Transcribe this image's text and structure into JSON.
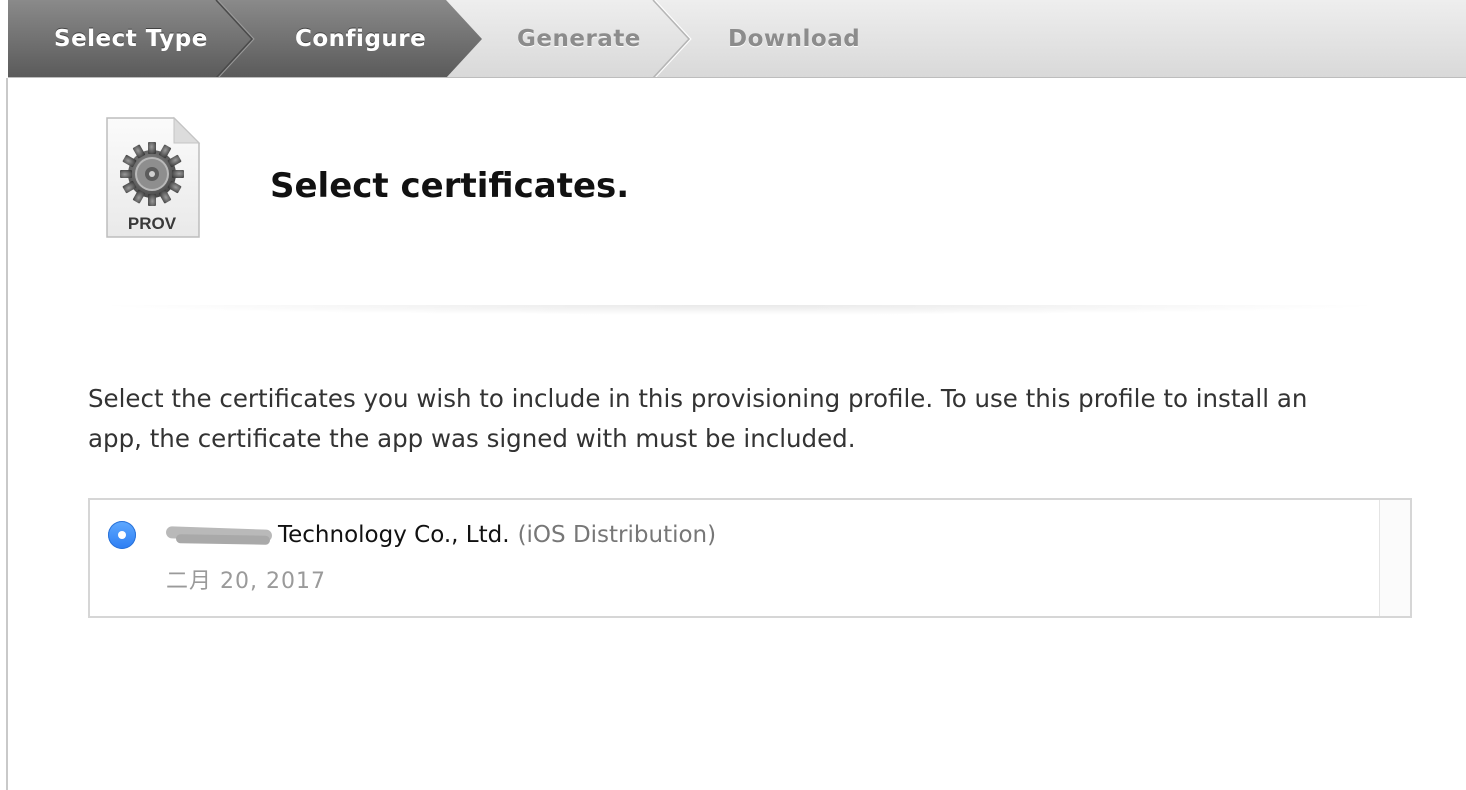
{
  "wizard": {
    "steps": [
      {
        "label": "Select Type",
        "state": "completed"
      },
      {
        "label": "Configure",
        "state": "current"
      },
      {
        "label": "Generate",
        "state": "upcoming"
      },
      {
        "label": "Download",
        "state": "upcoming"
      }
    ]
  },
  "header": {
    "icon_label": "PROV",
    "title": "Select certificates."
  },
  "description": "Select the certificates you wish to include in this provisioning profile. To use this profile to install an app, the certificate the app was signed with must be included.",
  "certificates": [
    {
      "name": "Technology Co., Ltd.",
      "type": "(iOS Distribution)",
      "date": "二月 20, 2017",
      "selected": true
    }
  ],
  "colors": {
    "accent": "#2d7ef3",
    "active_step": "#6b6b6b",
    "inactive_step_text": "#8c8c8c"
  }
}
